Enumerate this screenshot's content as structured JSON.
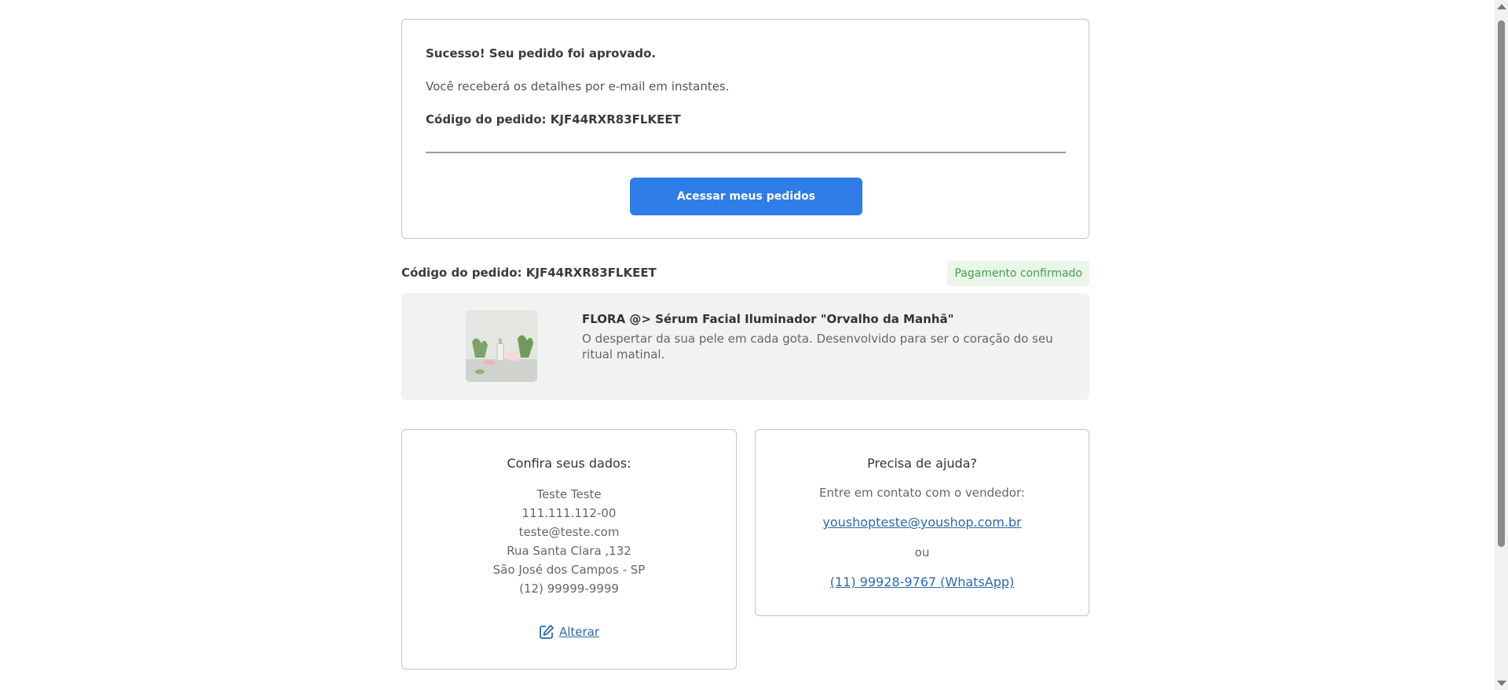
{
  "success": {
    "title": "Sucesso! Seu pedido foi aprovado.",
    "message": "Você receberá os detalhes por e-mail em instantes.",
    "code_line": "Código do pedido: KJF44RXR83FLKEET",
    "button_label": "Acessar meus pedidos"
  },
  "order": {
    "code_line": "Código do pedido: KJF44RXR83FLKEET",
    "status": "Pagamento confirmado"
  },
  "product": {
    "name": "FLORA @> Sérum Facial Iluminador \"Orvalho da Manhã\"",
    "description": "O despertar da sua pele em cada gota. Desenvolvido para ser o coração do seu ritual matinal."
  },
  "customer": {
    "title": "Confira seus dados:",
    "name": "Teste Teste",
    "document": "111.111.112-00",
    "email": "teste@teste.com",
    "address": "Rua Santa Clara ,132",
    "city": "São José dos Campos - SP",
    "phone": "(12) 99999-9999",
    "edit_label": "Alterar"
  },
  "help": {
    "title": "Precisa de ajuda?",
    "contact_text": "Entre em contato com o vendedor:",
    "email_link": "youshopteste@youshop.com.br",
    "or_text": "ou",
    "whatsapp_link": "(11) 99928-9767 (WhatsApp)"
  },
  "colors": {
    "accent": "#2f7de6",
    "status_green": "#43a047",
    "link": "#2c6aa8"
  },
  "icons": {
    "edit": "edit-icon",
    "scroll_up": "chevron-up-icon",
    "scroll_down": "chevron-down-icon"
  }
}
